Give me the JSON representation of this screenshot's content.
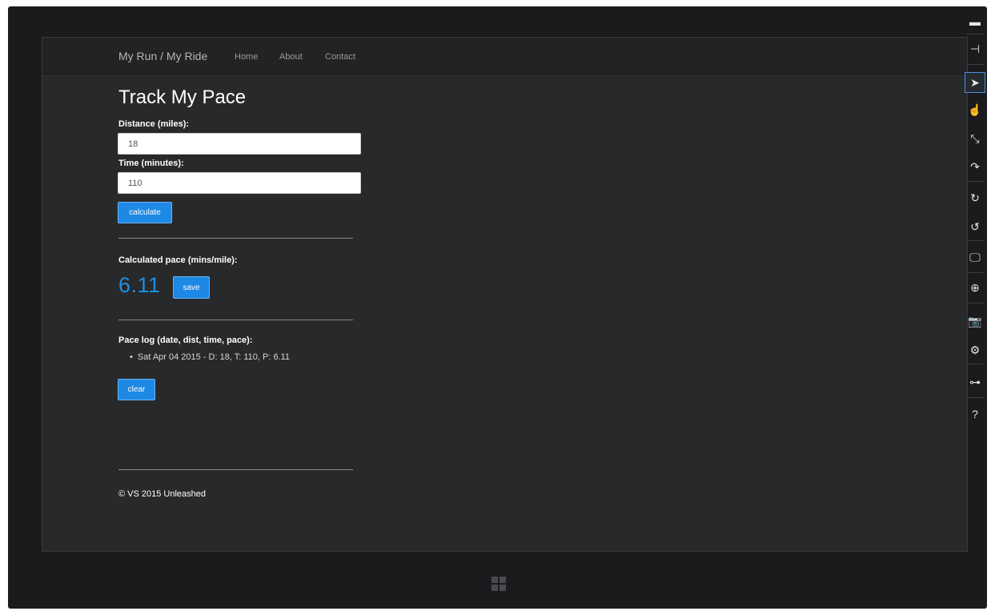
{
  "navbar": {
    "brand": "My Run / My Ride",
    "links": [
      "Home",
      "About",
      "Contact"
    ]
  },
  "form": {
    "title": "Track My Pace",
    "distance_label": "Distance (miles):",
    "distance_value": "18",
    "time_label": "Time (minutes):",
    "time_value": "110",
    "calculate_label": "calculate"
  },
  "result": {
    "label": "Calculated pace (mins/mile):",
    "pace": "6.11",
    "save_label": "save"
  },
  "log": {
    "label": "Pace log (date, dist, time, pace):",
    "entries": [
      "Sat Apr 04 2015 - D: 18, T: 110, P: 6.11"
    ],
    "clear_label": "clear"
  },
  "footer": {
    "text": "© VS 2015 Unleashed"
  },
  "toolbar": {
    "tools": [
      {
        "icon": "minimize-icon",
        "glyph": "▬"
      },
      {
        "icon": "pin-icon",
        "glyph": "⊣"
      },
      {
        "icon": "pointer-icon",
        "glyph": "➤"
      },
      {
        "icon": "hand-icon",
        "glyph": "☝"
      },
      {
        "icon": "pinch-zoom-icon",
        "glyph": "⤡"
      },
      {
        "icon": "rotate-touch-icon",
        "glyph": "↷"
      },
      {
        "icon": "rotate-clockwise-icon",
        "glyph": "↻"
      },
      {
        "icon": "rotate-counterclockwise-icon",
        "glyph": "↺"
      },
      {
        "icon": "resolution-icon",
        "glyph": "🖵"
      },
      {
        "icon": "location-icon",
        "glyph": "⊕"
      },
      {
        "icon": "screenshot-icon",
        "glyph": "📷"
      },
      {
        "icon": "settings-icon",
        "glyph": "⚙"
      },
      {
        "icon": "network-icon",
        "glyph": "⊶"
      },
      {
        "icon": "help-icon",
        "glyph": "?"
      }
    ],
    "active_tool": "pointer-icon"
  },
  "colors": {
    "accent": "#1e88e5",
    "pace": "#1e8fe0",
    "background": "#28292b",
    "navbar": "#222325"
  }
}
